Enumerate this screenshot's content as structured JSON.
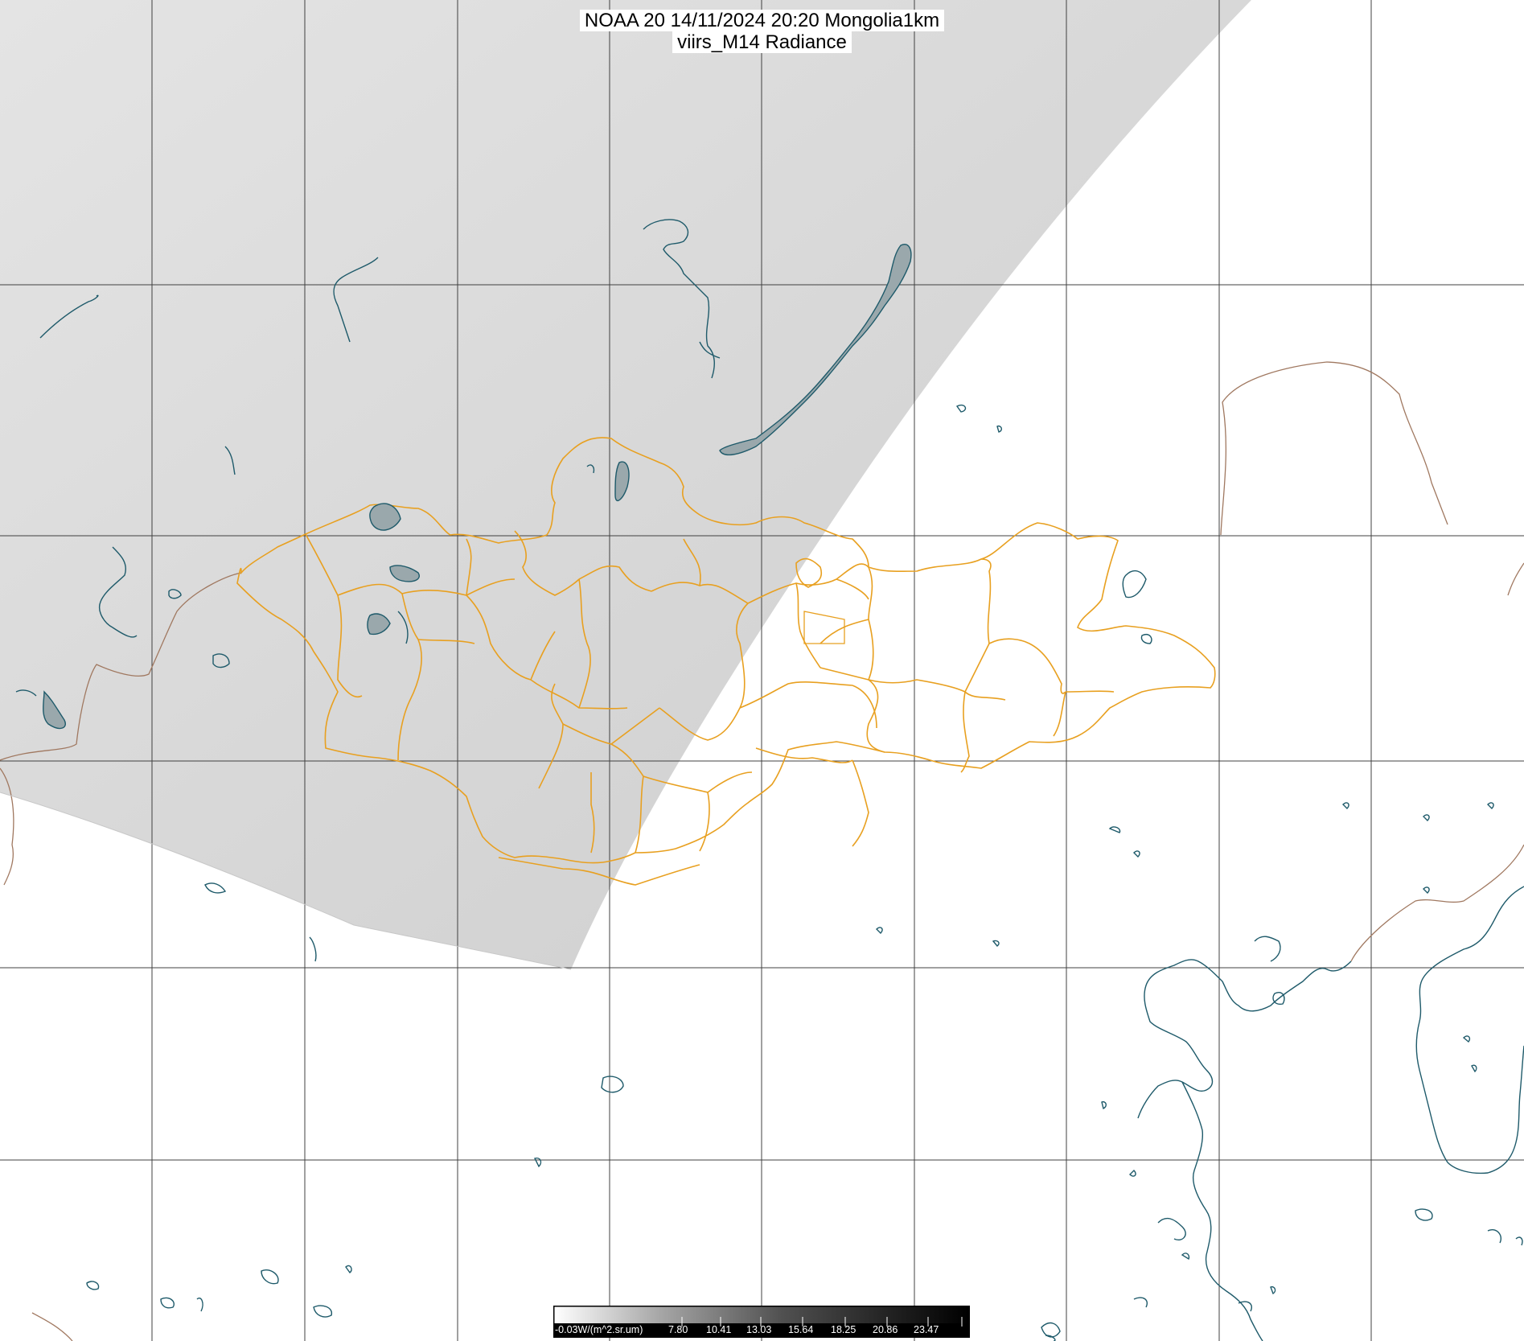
{
  "title": {
    "line1": "NOAA 20 14/11/2024 20:20 Mongolia1km",
    "line2": "viirs_M14 Radiance"
  },
  "colorbar": {
    "unit_label": "-0.03W/(m^2.sr.um)",
    "tick_labels": [
      "7.80",
      "10.41",
      "13.03",
      "15.64",
      "18.25",
      "20.86",
      "23.47"
    ],
    "value_min": -0.03,
    "value_max": 26.08
  },
  "colors": {
    "grid": "#404040",
    "swath": "#dcdcdc",
    "province_border": "#e8a020",
    "country_border": "#a07860",
    "water": "#1e5a6a",
    "lake_fill": "#9aa8ac"
  }
}
